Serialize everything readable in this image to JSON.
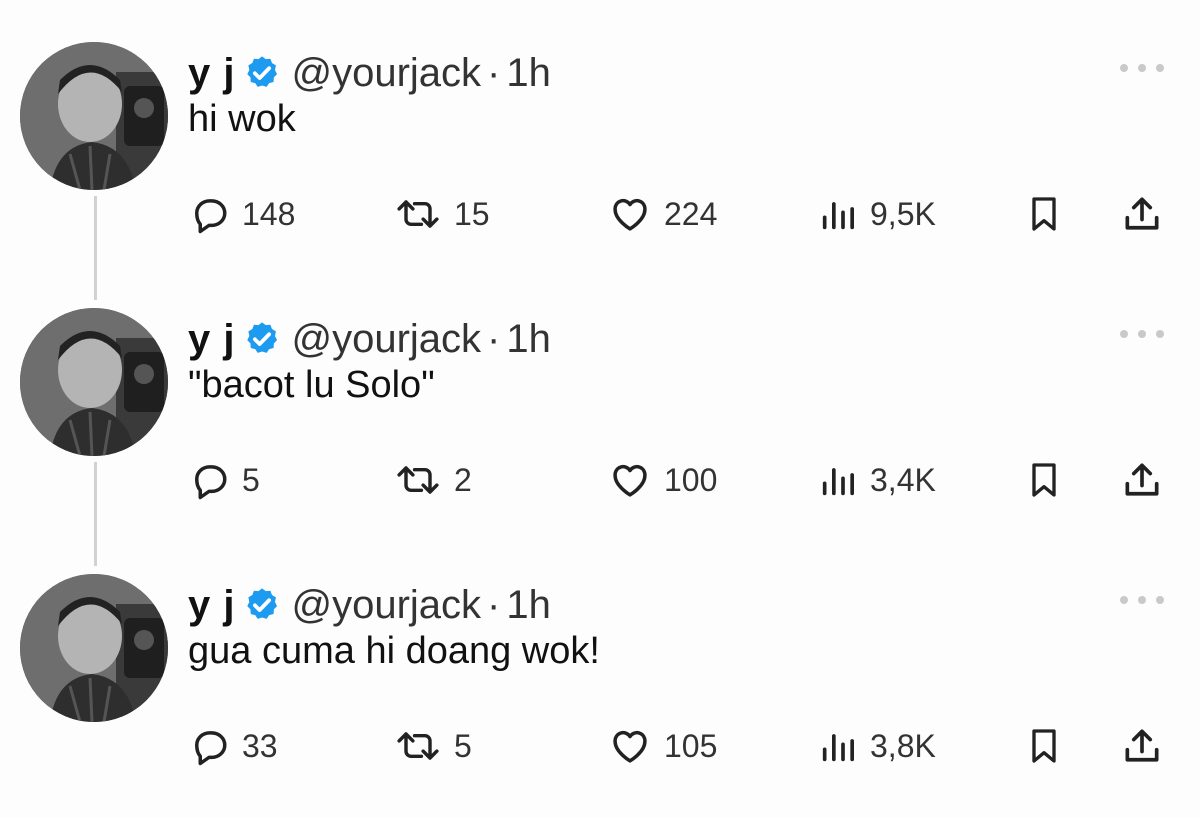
{
  "colors": {
    "verified_badge": "#1d9bf0",
    "thread_line": "#cfd3d6",
    "text": "#111111",
    "muted": "#333333"
  },
  "icons": {
    "reply": "speech-bubble-icon",
    "retweet": "retweet-arrows-icon",
    "like": "heart-icon",
    "views": "bar-chart-icon",
    "bookmark": "bookmark-icon",
    "share": "upload-share-icon",
    "more": "three-dots-icon",
    "verified": "verified-badge-icon"
  },
  "tweets": [
    {
      "name": "y j",
      "handle": "@yourjack",
      "separator": "·",
      "time": "1h",
      "text": "hi wok",
      "replies": "148",
      "retweets": "15",
      "likes": "224",
      "views": "9,5K"
    },
    {
      "name": "y j",
      "handle": "@yourjack",
      "separator": "·",
      "time": "1h",
      "text": "\"bacot lu Solo\"",
      "replies": "5",
      "retweets": "2",
      "likes": "100",
      "views": "3,4K"
    },
    {
      "name": "y j",
      "handle": "@yourjack",
      "separator": "·",
      "time": "1h",
      "text": "gua cuma hi doang wok!",
      "replies": "33",
      "retweets": "5",
      "likes": "105",
      "views": "3,8K"
    }
  ]
}
